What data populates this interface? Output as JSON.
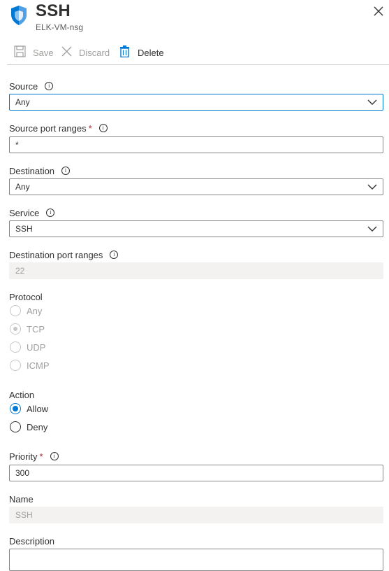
{
  "header": {
    "title": "SSH",
    "subtitle": "ELK-VM-nsg"
  },
  "toolbar": {
    "save_label": "Save",
    "discard_label": "Discard",
    "delete_label": "Delete"
  },
  "form": {
    "source": {
      "label": "Source",
      "value": "Any"
    },
    "source_port_ranges": {
      "label": "Source port ranges",
      "required_mark": "*",
      "value": "*"
    },
    "destination": {
      "label": "Destination",
      "value": "Any"
    },
    "service": {
      "label": "Service",
      "value": "SSH"
    },
    "destination_port_ranges": {
      "label": "Destination port ranges",
      "value": "22"
    },
    "protocol": {
      "label": "Protocol",
      "options": [
        "Any",
        "TCP",
        "UDP",
        "ICMP"
      ],
      "selected": "TCP"
    },
    "action": {
      "label": "Action",
      "options": [
        "Allow",
        "Deny"
      ],
      "selected": "Allow"
    },
    "priority": {
      "label": "Priority",
      "required_mark": "*",
      "value": "300"
    },
    "name": {
      "label": "Name",
      "value": "SSH"
    },
    "description": {
      "label": "Description",
      "value": ""
    }
  },
  "colors": {
    "accent": "#0078d4",
    "required": "#a4262c",
    "disabled_text": "#a19f9d"
  },
  "icons": {
    "header": "shield-icon",
    "close": "close-icon",
    "save": "save-icon",
    "discard": "discard-icon",
    "delete": "trash-icon",
    "info": "info-icon",
    "dropdown": "chevron-down-icon"
  }
}
